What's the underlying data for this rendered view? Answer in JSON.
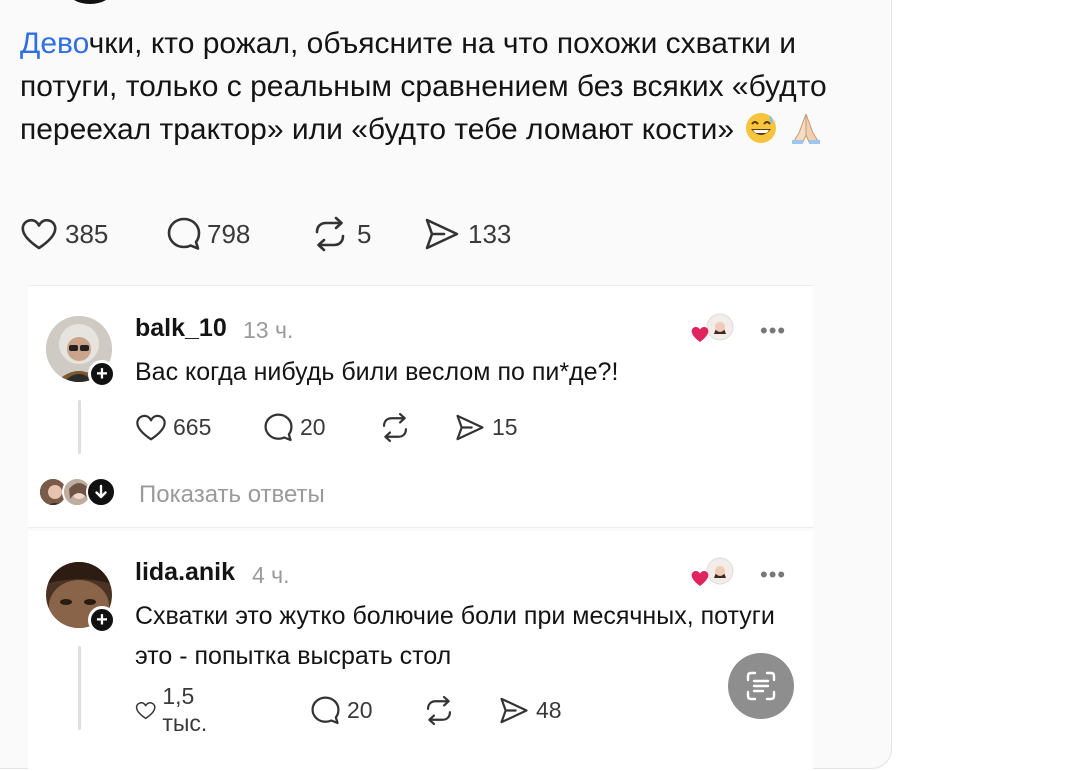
{
  "post": {
    "mention": "Дево",
    "text": "чки, кто рожал, объясните на что похожи схватки и потуги, только с реальным сравнением без всяких «будто переехал трактор» или «будто тебе ломают кости»",
    "emojis": [
      "grinning-sweat-emoji",
      "folded-hands-emoji"
    ],
    "likes": "385",
    "comments": "798",
    "reposts": "5",
    "shares": "133"
  },
  "comments": [
    {
      "username": "balk_10",
      "time": "13 ч.",
      "text": "Вас когда нибудь били веслом по пи*де?!",
      "likes": "665",
      "replies": "20",
      "reposts": "",
      "shares": "15",
      "more": "•••"
    },
    {
      "username": "lida.anik",
      "time": "4 ч.",
      "text": "Схватки это жутко болючие боли при месячных, потуги это - попытка высрать стол",
      "likes": "1,5 тыс.",
      "replies": "20",
      "reposts": "",
      "shares": "48",
      "more": "•••"
    }
  ],
  "show_replies": {
    "label": "Показать ответы"
  },
  "colors": {
    "mention": "#2f6fe0",
    "like_heart": "#e0245e",
    "muted_text": "#9a9a9a",
    "scan_button": "#8e8e8e"
  },
  "icons": [
    "heart-icon",
    "comment-icon",
    "repost-icon",
    "send-icon",
    "plus-icon",
    "more-icon",
    "chevron-down-icon",
    "text-scan-icon"
  ]
}
